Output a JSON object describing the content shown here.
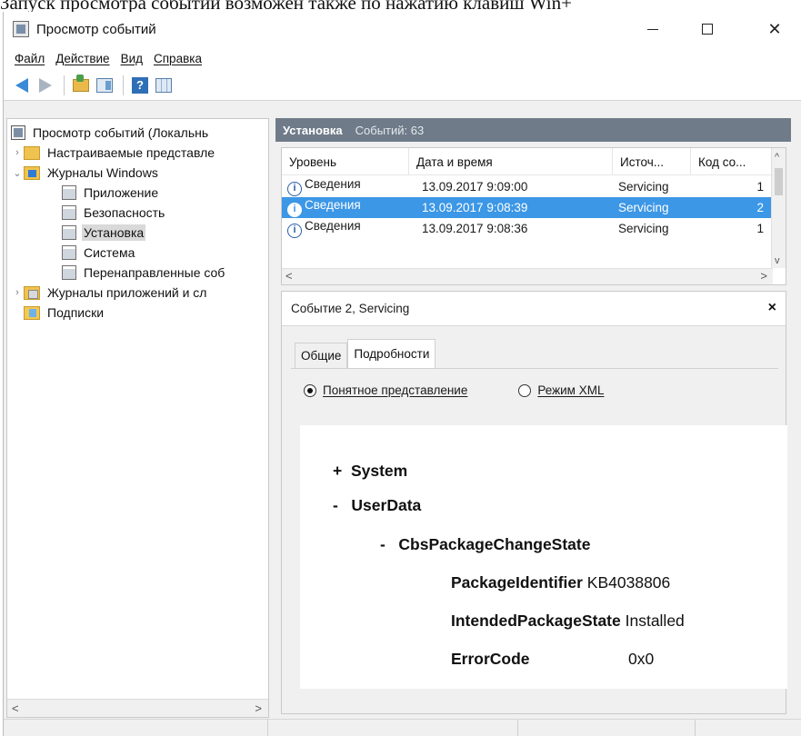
{
  "caption": {
    "text": "Запуск просмотра событий возможен также по нажатию клавиш Win+"
  },
  "window": {
    "title": "Просмотр событий",
    "controls": {
      "minimize": "—",
      "maximize": "☐",
      "close": "✕"
    }
  },
  "menu": [
    "Файл",
    "Действие",
    "Вид",
    "Справка"
  ],
  "tree": {
    "items": [
      {
        "label": "Просмотр событий (Локальнь",
        "icon": "event-viewer-icon",
        "chevron": ""
      },
      {
        "label": "Настраиваемые представле",
        "icon": "folder-icon",
        "chevron": "›"
      },
      {
        "label": "Журналы Windows",
        "icon": "windows-logs-folder-icon",
        "chevron": "⌄"
      },
      {
        "label": "Приложение",
        "icon": "log-icon",
        "chevron": ""
      },
      {
        "label": "Безопасность",
        "icon": "log-icon",
        "chevron": ""
      },
      {
        "label": "Установка",
        "icon": "log-icon",
        "chevron": "",
        "selected": true
      },
      {
        "label": "Система",
        "icon": "log-icon",
        "chevron": ""
      },
      {
        "label": "Перенаправленные соб",
        "icon": "log-icon",
        "chevron": ""
      },
      {
        "label": "Журналы приложений и сл",
        "icon": "folder-icon",
        "chevron": "›"
      },
      {
        "label": "Подписки",
        "icon": "subscriptions-icon",
        "chevron": ""
      }
    ],
    "scroll_left": "<",
    "scroll_right": ">"
  },
  "list_header": {
    "title": "Установка",
    "count": "Событий: 63"
  },
  "event_list": {
    "columns": [
      "Уровень",
      "Дата и время",
      "Источ...",
      "Код со..."
    ],
    "rows": [
      {
        "level": "Сведения",
        "datetime": "13.09.2017 9:09:00",
        "source": "Servicing",
        "code": "1"
      },
      {
        "level": "Сведения",
        "datetime": "13.09.2017 9:08:39",
        "source": "Servicing",
        "code": "2",
        "selected": true
      },
      {
        "level": "Сведения",
        "datetime": "13.09.2017 9:08:36",
        "source": "Servicing",
        "code": "1"
      }
    ],
    "scroll_left": "<",
    "scroll_right": ">"
  },
  "detail": {
    "title": "Событие 2, Servicing",
    "close": "×",
    "tabs": [
      "Общие",
      "Подробности"
    ],
    "active_tab": 1,
    "radio_friendly": "Понятное представление",
    "radio_xml": "Режим XML",
    "tree": [
      {
        "prefix": "+",
        "key": "System",
        "value": ""
      },
      {
        "prefix": "-",
        "key": "UserData",
        "value": ""
      },
      {
        "prefix": "-",
        "key": "CbsPackageChangeState",
        "value": ""
      },
      {
        "prefix": "",
        "key": "PackageIdentifier",
        "value": "KB4038806"
      },
      {
        "prefix": "",
        "key": "IntendedPackageState",
        "value": "Installed"
      },
      {
        "prefix": "",
        "key": "ErrorCode",
        "value": "0x0"
      }
    ]
  },
  "colors": {
    "header_bg": "#6f7b88",
    "selection": "#3c97e6",
    "tree_selection": "#d9d9d9"
  }
}
